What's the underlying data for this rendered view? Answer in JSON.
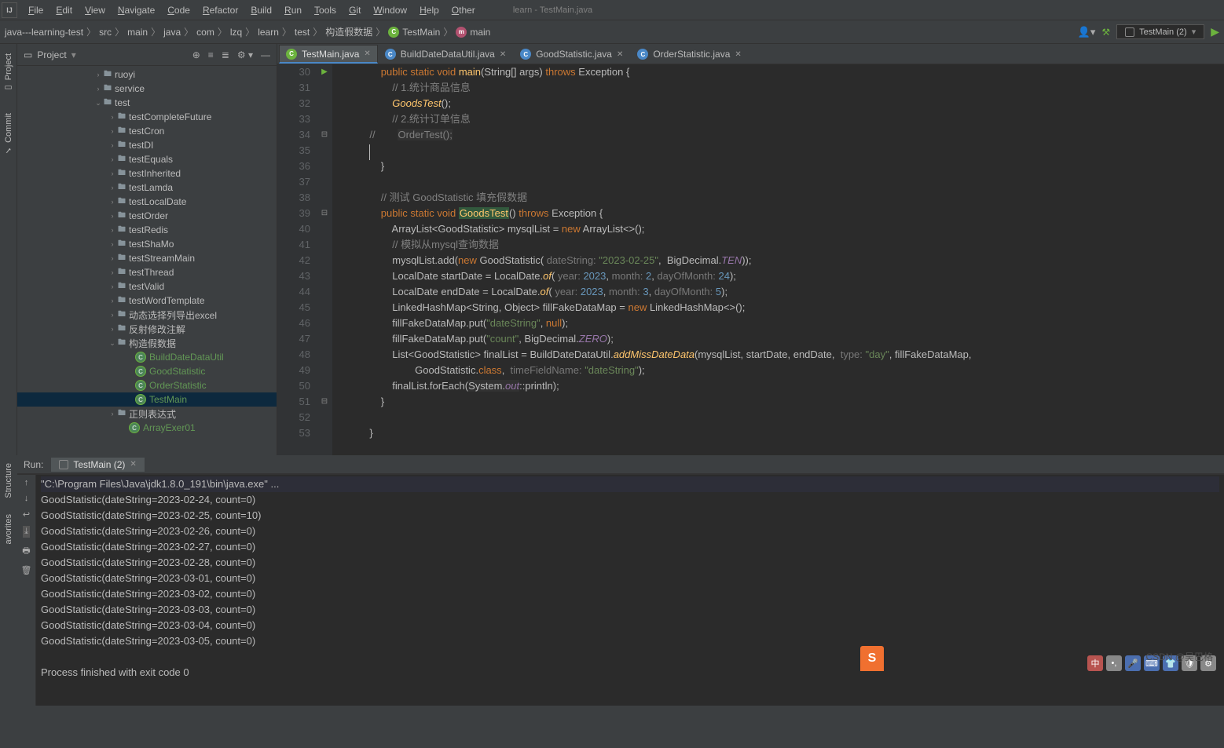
{
  "window": {
    "title": "learn - TestMain.java"
  },
  "menu": [
    "File",
    "Edit",
    "View",
    "Navigate",
    "Code",
    "Refactor",
    "Build",
    "Run",
    "Tools",
    "Git",
    "Window",
    "Help",
    "Other"
  ],
  "breadcrumb": [
    "java---learning-test",
    "src",
    "main",
    "java",
    "com",
    "lzq",
    "learn",
    "test",
    "构造假数据",
    "TestMain",
    "main"
  ],
  "runConfig": "TestMain (2)",
  "projectPanel": {
    "title": "Project"
  },
  "tree": [
    {
      "indent": 96,
      "arrow": "›",
      "icon": "folder",
      "label": "ruoyi"
    },
    {
      "indent": 96,
      "arrow": "›",
      "icon": "folder",
      "label": "service"
    },
    {
      "indent": 96,
      "arrow": "⌄",
      "icon": "folder",
      "label": "test"
    },
    {
      "indent": 114,
      "arrow": "›",
      "icon": "folder",
      "label": "testCompleteFuture"
    },
    {
      "indent": 114,
      "arrow": "›",
      "icon": "folder",
      "label": "testCron"
    },
    {
      "indent": 114,
      "arrow": "›",
      "icon": "folder",
      "label": "testDI"
    },
    {
      "indent": 114,
      "arrow": "›",
      "icon": "folder",
      "label": "testEquals"
    },
    {
      "indent": 114,
      "arrow": "›",
      "icon": "folder",
      "label": "testInherited"
    },
    {
      "indent": 114,
      "arrow": "›",
      "icon": "folder",
      "label": "testLamda"
    },
    {
      "indent": 114,
      "arrow": "›",
      "icon": "folder",
      "label": "testLocalDate"
    },
    {
      "indent": 114,
      "arrow": "›",
      "icon": "folder",
      "label": "testOrder"
    },
    {
      "indent": 114,
      "arrow": "›",
      "icon": "folder",
      "label": "testRedis"
    },
    {
      "indent": 114,
      "arrow": "›",
      "icon": "folder",
      "label": "testShaMo"
    },
    {
      "indent": 114,
      "arrow": "›",
      "icon": "folder",
      "label": "testStreamMain"
    },
    {
      "indent": 114,
      "arrow": "›",
      "icon": "folder",
      "label": "testThread"
    },
    {
      "indent": 114,
      "arrow": "›",
      "icon": "folder",
      "label": "testValid"
    },
    {
      "indent": 114,
      "arrow": "›",
      "icon": "folder",
      "label": "testWordTemplate"
    },
    {
      "indent": 114,
      "arrow": "›",
      "icon": "folder",
      "label": "动态选择列导出excel"
    },
    {
      "indent": 114,
      "arrow": "›",
      "icon": "folder",
      "label": "反射修改注解"
    },
    {
      "indent": 114,
      "arrow": "⌄",
      "icon": "folder",
      "label": "构造假数据"
    },
    {
      "indent": 136,
      "arrow": "",
      "icon": "class",
      "label": "BuildDateDataUtil",
      "green": true
    },
    {
      "indent": 136,
      "arrow": "",
      "icon": "class",
      "label": "GoodStatistic",
      "green": true
    },
    {
      "indent": 136,
      "arrow": "",
      "icon": "class",
      "label": "OrderStatistic",
      "green": true
    },
    {
      "indent": 136,
      "arrow": "",
      "icon": "class",
      "label": "TestMain",
      "green": true,
      "selected": true
    },
    {
      "indent": 114,
      "arrow": "›",
      "icon": "folder",
      "label": "正则表达式"
    },
    {
      "indent": 128,
      "arrow": "",
      "icon": "class",
      "label": "ArrayExer01",
      "green": true
    }
  ],
  "tabs": [
    {
      "label": "TestMain.java",
      "active": true,
      "ic": "c"
    },
    {
      "label": "BuildDateDataUtil.java",
      "ic": "j"
    },
    {
      "label": "GoodStatistic.java",
      "ic": "j"
    },
    {
      "label": "OrderStatistic.java",
      "ic": "j"
    }
  ],
  "lineStart": 30,
  "lineEnd": 53,
  "gutterMarks": {
    "30": "▶",
    "34": "⊟",
    "39": "⊟",
    "51": "⊟"
  },
  "runTab": "TestMain (2)",
  "runLabel": "Run:",
  "console": [
    "\"C:\\Program Files\\Java\\jdk1.8.0_191\\bin\\java.exe\" ...",
    "GoodStatistic(dateString=2023-02-24, count=0)",
    "GoodStatistic(dateString=2023-02-25, count=10)",
    "GoodStatistic(dateString=2023-02-26, count=0)",
    "GoodStatistic(dateString=2023-02-27, count=0)",
    "GoodStatistic(dateString=2023-02-28, count=0)",
    "GoodStatistic(dateString=2023-03-01, count=0)",
    "GoodStatistic(dateString=2023-03-02, count=0)",
    "GoodStatistic(dateString=2023-03-03, count=0)",
    "GoodStatistic(dateString=2023-03-04, count=0)",
    "GoodStatistic(dateString=2023-03-05, count=0)",
    "",
    "Process finished with exit code 0"
  ],
  "watermark": "CSDN @吴巴格"
}
